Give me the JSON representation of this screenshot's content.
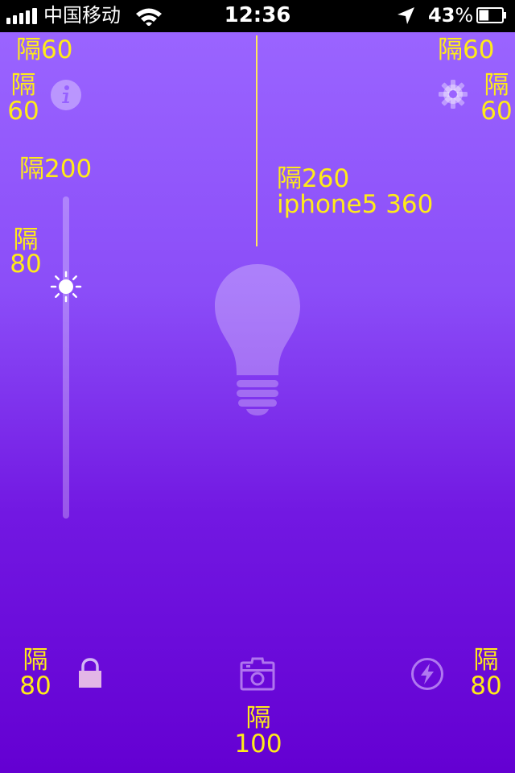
{
  "status_bar": {
    "carrier": "中国移动",
    "time": "12:36",
    "battery_percent": "43",
    "battery_suffix": "%",
    "signal_icon": "signal-bars-icon",
    "wifi_icon": "wifi-icon",
    "location_icon": "location-arrow-icon",
    "battery_icon": "battery-icon"
  },
  "annotations": {
    "top_left": "隔60",
    "top_right": "隔60",
    "info_left_1": "隔",
    "info_left_2": "60",
    "settings_right_1": "隔",
    "settings_right_2": "60",
    "slider_top": "隔200",
    "center_1": "隔260",
    "center_2": "iphone5 360",
    "slider_left_1": "隔",
    "slider_left_2": "80",
    "bottom_left_1": "隔",
    "bottom_left_2": "80",
    "bottom_right_1": "隔",
    "bottom_right_2": "80",
    "bottom_center_1": "隔",
    "bottom_center_2": "100"
  },
  "brightness": {
    "value": 0.72
  },
  "colors": {
    "annotation": "#ffeb19",
    "background_top": "#9a64ff",
    "background_bottom": "#6400d2"
  },
  "icons": [
    "info-icon",
    "gear-icon",
    "sun-icon",
    "lightbulb-icon",
    "lock-icon",
    "camera-icon",
    "flash-icon"
  ]
}
